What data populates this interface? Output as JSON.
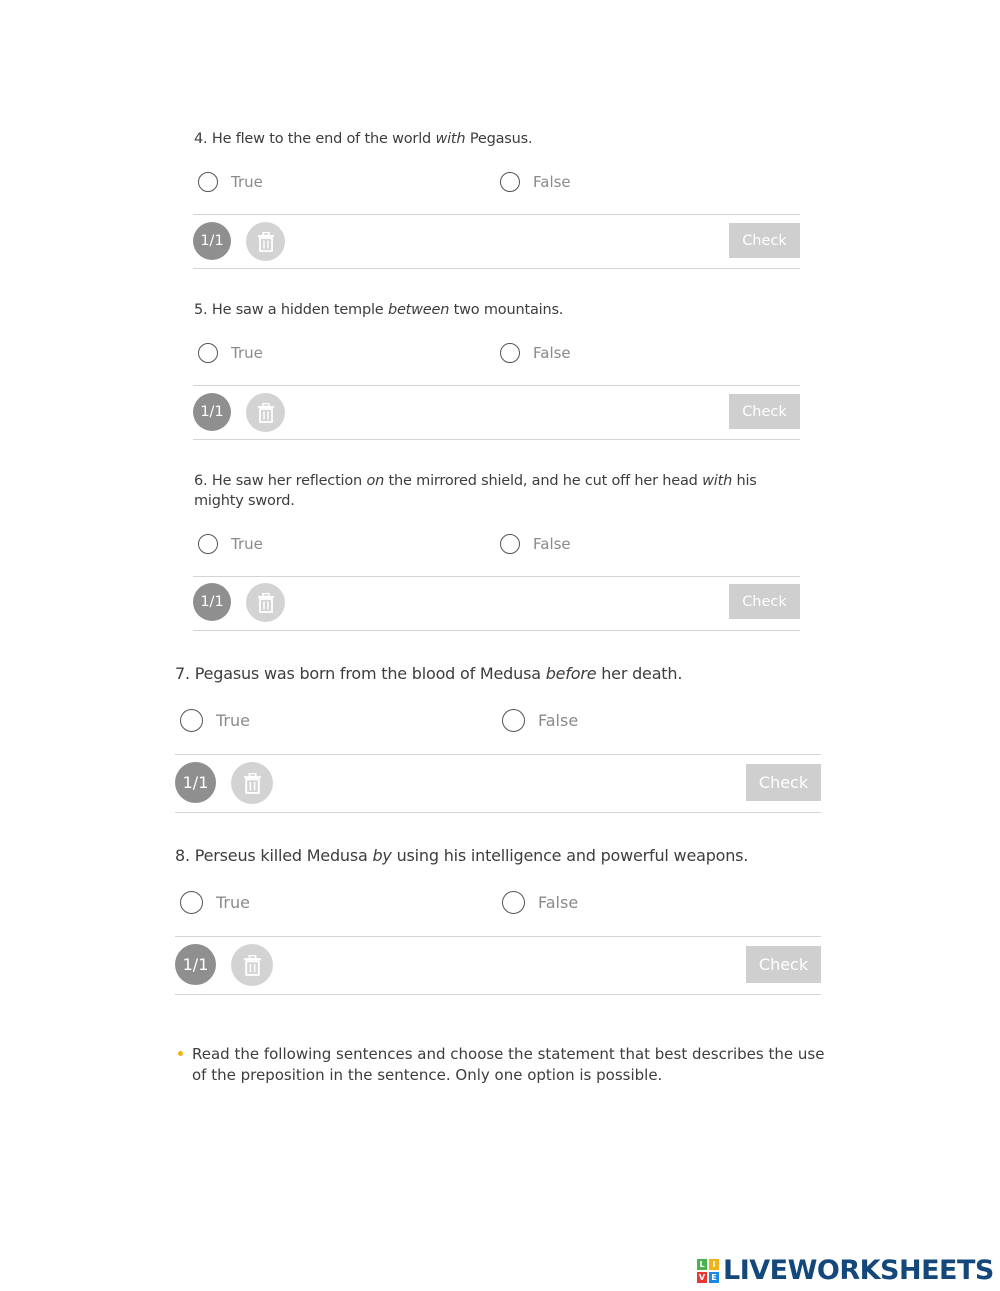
{
  "questions": [
    {
      "num": "4.",
      "pre": "He flew to the end of the world ",
      "em": "with",
      "post": " Pegasus.",
      "true_label": "True",
      "false_label": "False",
      "score": "1/1",
      "check_label": "Check"
    },
    {
      "num": "5.",
      "pre": "He saw a hidden temple ",
      "em": "between",
      "post": " two mountains.",
      "true_label": "True",
      "false_label": "False",
      "score": "1/1",
      "check_label": "Check"
    },
    {
      "num": "6.",
      "pre": "He saw her reflection ",
      "em": "on",
      "mid": " the mirrored shield, and he cut off her head ",
      "em2": "with",
      "post": " his mighty sword.",
      "true_label": "True",
      "false_label": "False",
      "score": "1/1",
      "check_label": "Check"
    },
    {
      "num": "7.",
      "pre": "Pegasus was born from the blood of Medusa ",
      "em": "before",
      "post": " her death.",
      "true_label": "True",
      "false_label": "False",
      "score": "1/1",
      "check_label": "Check"
    },
    {
      "num": "8.",
      "pre": "Perseus killed Medusa ",
      "em": "by",
      "post": " using his intelligence and powerful weapons.",
      "true_label": "True",
      "false_label": "False",
      "score": "1/1",
      "check_label": "Check"
    }
  ],
  "instruction": "Read the following sentences and choose the statement that best describes the use of the preposition in the sentence. Only one option is possible.",
  "logo": {
    "text": "LIVEWORKSHEETS",
    "letters": [
      "L",
      "I",
      "V",
      "E"
    ],
    "colors": [
      "#4caf50",
      "#f2b21a",
      "#e53935",
      "#1e88e5"
    ]
  },
  "colors": {
    "accent_bullet": "#f2b21a",
    "score_bg": "#8f8f8f",
    "check_bg": "#cfcfcf"
  }
}
